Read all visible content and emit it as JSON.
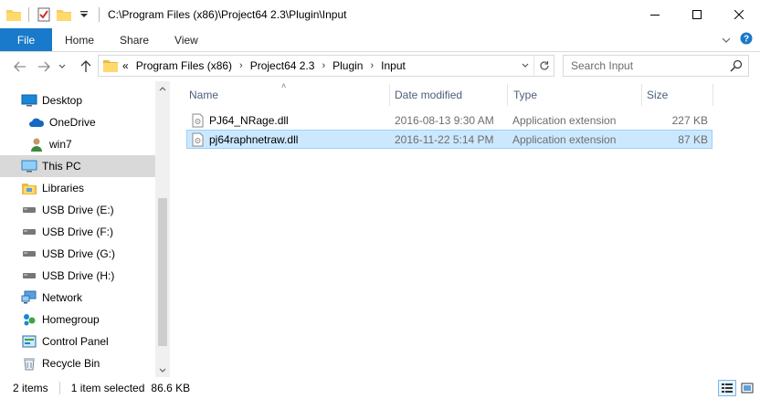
{
  "window": {
    "title": "C:\\Program Files (x86)\\Project64 2.3\\Plugin\\Input"
  },
  "ribbon": {
    "tabs": [
      {
        "label": "File"
      },
      {
        "label": "Home"
      },
      {
        "label": "Share"
      },
      {
        "label": "View"
      }
    ]
  },
  "address": {
    "overflow": "«",
    "crumbs": [
      "Program Files (x86)",
      "Project64 2.3",
      "Plugin",
      "Input"
    ]
  },
  "search": {
    "placeholder": "Search Input"
  },
  "navpane": {
    "items": [
      {
        "label": "Desktop",
        "icon": "desktop-icon"
      },
      {
        "label": "OneDrive",
        "icon": "onedrive-icon"
      },
      {
        "label": "win7",
        "icon": "user-icon"
      },
      {
        "label": "This PC",
        "icon": "this-pc-icon",
        "selected": true
      },
      {
        "label": "Libraries",
        "icon": "libraries-icon"
      },
      {
        "label": "USB Drive (E:)",
        "icon": "usb-drive-icon"
      },
      {
        "label": "USB Drive (F:)",
        "icon": "usb-drive-icon"
      },
      {
        "label": "USB Drive (G:)",
        "icon": "usb-drive-icon"
      },
      {
        "label": "USB Drive (H:)",
        "icon": "usb-drive-icon"
      },
      {
        "label": "Network",
        "icon": "network-icon"
      },
      {
        "label": "Homegroup",
        "icon": "homegroup-icon"
      },
      {
        "label": "Control Panel",
        "icon": "control-panel-icon"
      },
      {
        "label": "Recycle Bin",
        "icon": "recycle-bin-icon"
      }
    ]
  },
  "filelist": {
    "columns": {
      "name": "Name",
      "date": "Date modified",
      "type": "Type",
      "size": "Size"
    },
    "rows": [
      {
        "name": "PJ64_NRage.dll",
        "date": "2016-08-13 9:30 AM",
        "type": "Application extension",
        "size": "227 KB",
        "selected": false
      },
      {
        "name": "pj64raphnetraw.dll",
        "date": "2016-11-22 5:14 PM",
        "type": "Application extension",
        "size": "87 KB",
        "selected": true
      }
    ]
  },
  "status": {
    "items": "2 items",
    "selected": "1 item selected",
    "size": "86.6 KB"
  },
  "colors": {
    "accent": "#1979ca",
    "selection": "#cce8ff",
    "selection_border": "#99d1ff",
    "nav_selected": "#d9d9d9"
  }
}
